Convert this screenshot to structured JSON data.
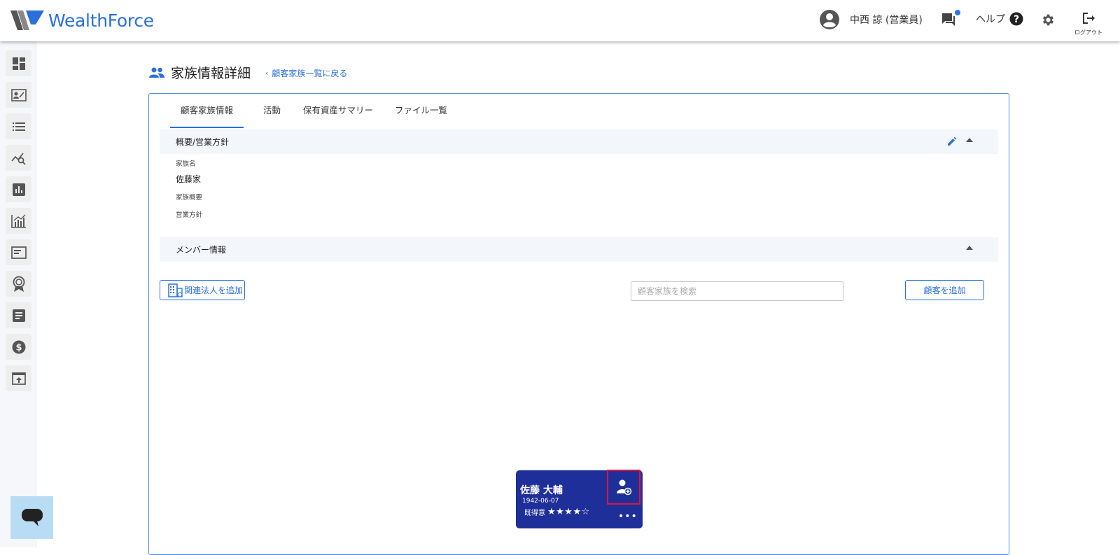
{
  "app": {
    "logo_text": "WealthForce"
  },
  "header": {
    "user_name": "中西 諒 (営業員)",
    "help_label": "ヘルプ",
    "logout_label": "ログアウト"
  },
  "sidebar": {
    "items": [
      {
        "icon": "dashboard-icon"
      },
      {
        "icon": "contact-card-icon"
      },
      {
        "icon": "list-icon"
      },
      {
        "icon": "trend-search-icon"
      },
      {
        "icon": "bar-chart-icon"
      },
      {
        "icon": "analytics-icon"
      },
      {
        "icon": "panel-icon"
      },
      {
        "icon": "award-icon"
      },
      {
        "icon": "document-icon"
      },
      {
        "icon": "dollar-icon"
      },
      {
        "icon": "upload-icon"
      }
    ]
  },
  "page": {
    "title": "家族情報詳細",
    "back_link": "顧客家族一覧に戻る"
  },
  "tabs": [
    {
      "label": "顧客家族情報",
      "active": true
    },
    {
      "label": "活動",
      "active": false
    },
    {
      "label": "保有資産サマリー",
      "active": false
    },
    {
      "label": "ファイル一覧",
      "active": false
    }
  ],
  "overview": {
    "section_title": "概要/営業方針",
    "family_name_label": "家族名",
    "family_name_value": "佐藤家",
    "family_summary_label": "家族概要",
    "sales_policy_label": "営業方針"
  },
  "members": {
    "section_title": "メンバー情報",
    "add_corp_button": "関連法人を追加",
    "search_placeholder": "顧客家族を検索",
    "add_customer_button": "顧客を追加",
    "card": {
      "name": "佐藤 大輔",
      "dob": "1942-06-07",
      "status": "既得意",
      "stars": "★★★★☆",
      "rating": 4,
      "more": "•••"
    }
  },
  "colors": {
    "accent": "#2a6fdb",
    "member_card_bg": "#1f2f99",
    "highlight": "#e0143c"
  }
}
